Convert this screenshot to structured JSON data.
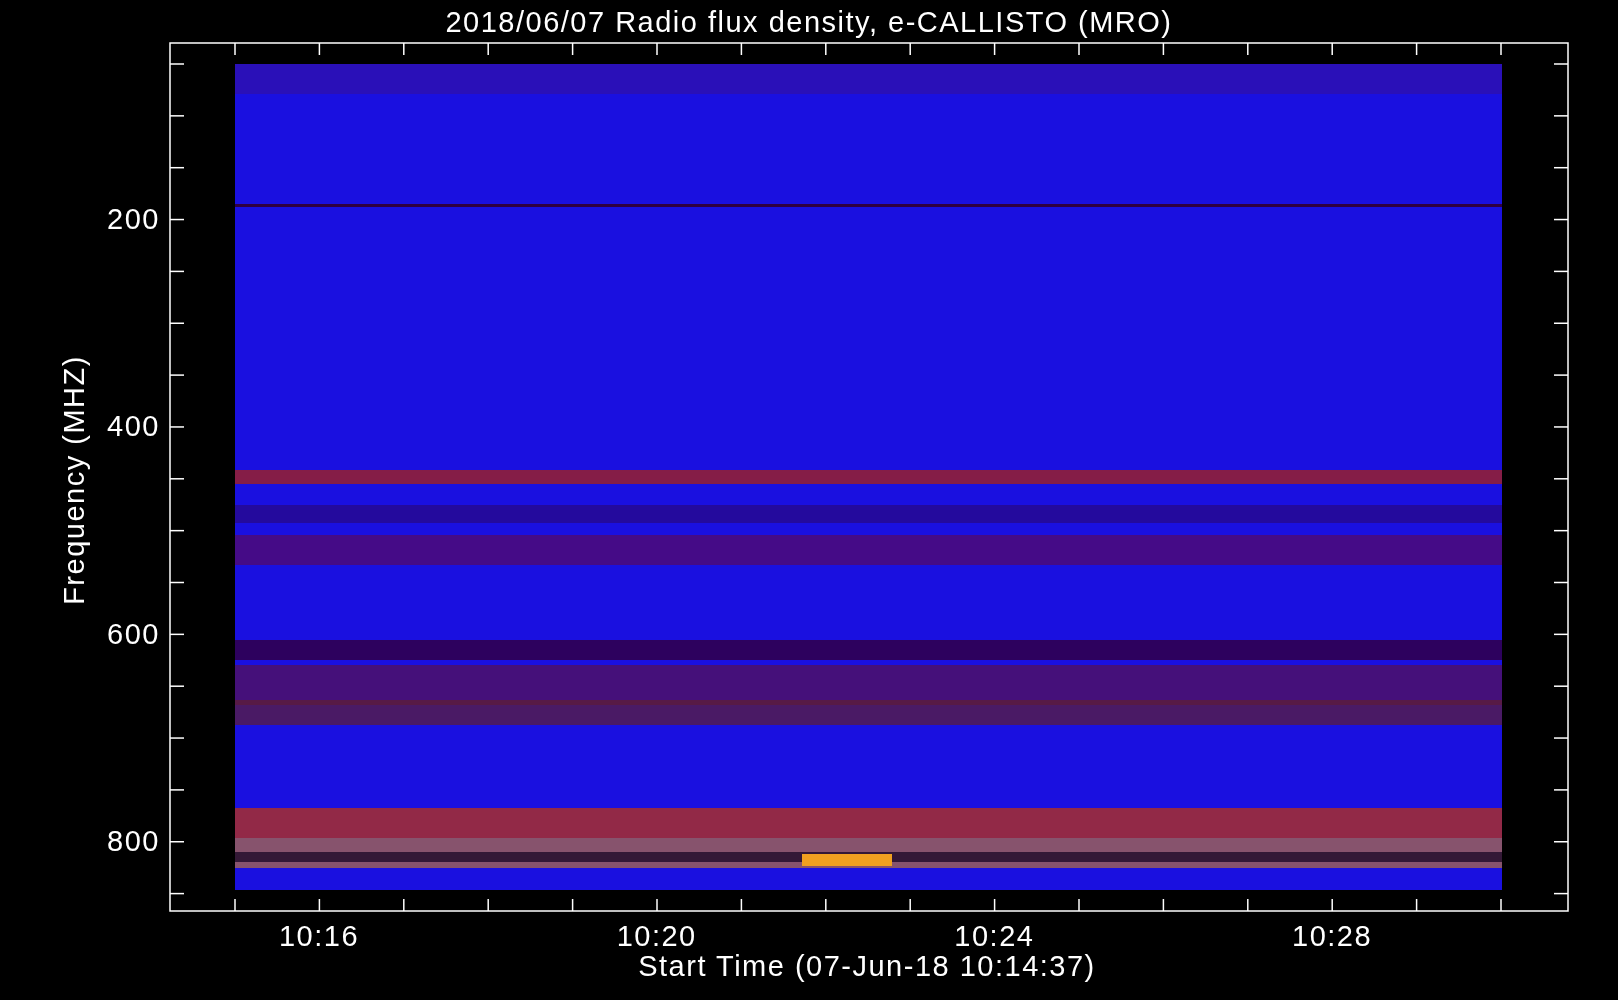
{
  "plot": {
    "title": "2018/06/07  Radio flux density, e-CALLISTO (MRO)",
    "xlabel": "Start Time (07-Jun-18 10:14:37)",
    "ylabel": "Frequency (MHZ)",
    "xticks": [
      "10:16",
      "10:20",
      "10:24",
      "10:28"
    ],
    "yticks": [
      "200",
      "400",
      "600",
      "800"
    ]
  }
}
